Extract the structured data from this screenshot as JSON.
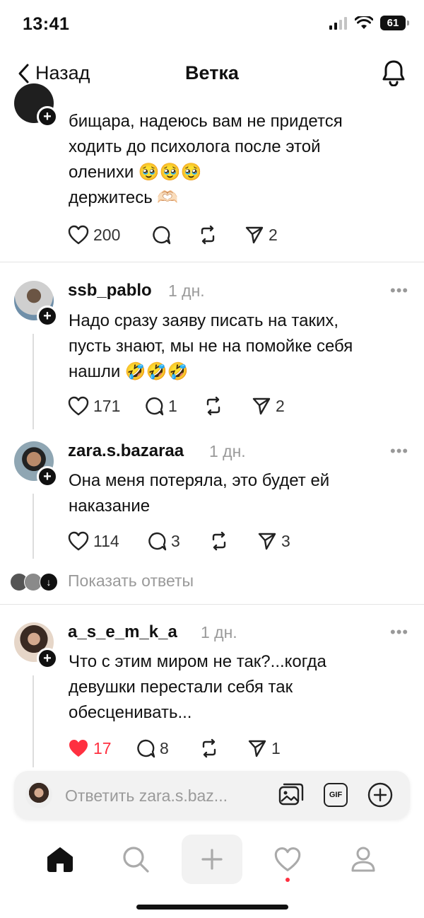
{
  "status_bar": {
    "time": "13:41",
    "battery": "61"
  },
  "nav": {
    "back_label": "Назад",
    "title": "Ветка"
  },
  "top_post": {
    "text_line1": "бищара, надеюсь вам не придется",
    "text_line2": "ходить до психолога после этой",
    "text_line3": "оленихи 🥹🥹🥹",
    "text_line4": "держитесь 🫶🏻",
    "likes": "200",
    "shares": "2"
  },
  "posts": [
    {
      "username": "ssb_pablo",
      "time": "1 дн.",
      "more": "•••",
      "text_line1": "Надо сразу заяву писать на таких,",
      "text_line2": "пусть знают, мы не на помойке себя",
      "text_line3": "нашли 🤣🤣🤣",
      "likes": "171",
      "replies": "1",
      "shares": "2"
    },
    {
      "username": "zara.s.bazaraa",
      "time": "1 дн.",
      "more": "•••",
      "text_line1": "Она меня потеряла, это будет ей",
      "text_line2": "наказание",
      "likes": "114",
      "replies": "3",
      "shares": "3"
    },
    {
      "username": "a_s_e_m_k_a",
      "time": "1 дн.",
      "more": "•••",
      "text_line1": "Что с этим миром не так?...когда",
      "text_line2": "девушки перестали себя так",
      "text_line3": "обесценивать...",
      "likes": "17",
      "replies": "8",
      "shares": "1"
    }
  ],
  "show_replies": "Показать ответы",
  "reply_bar": {
    "placeholder": "Ответить zara.s.baz..."
  },
  "colors": {
    "like_active": "#ff3040",
    "secondary_text": "#9a9a9a",
    "notification_dot": "#ff3040"
  }
}
